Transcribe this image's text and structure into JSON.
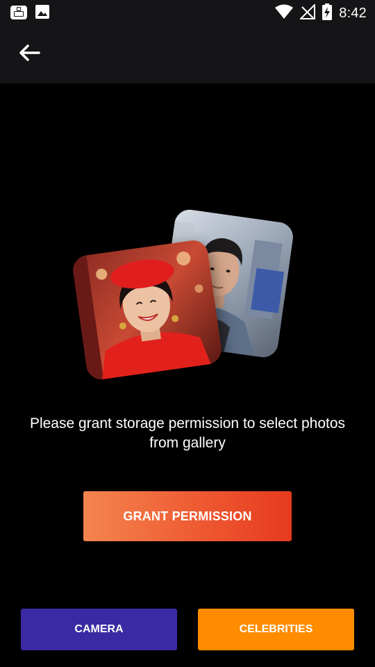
{
  "status_bar": {
    "time": "8:42",
    "icons": [
      "app-notification-icon",
      "image-notification-icon",
      "wifi-icon",
      "no-signal-icon",
      "battery-charging-icon"
    ]
  },
  "app_bar": {
    "back_icon": "arrow-left-icon"
  },
  "illustration": {
    "photos": [
      "woman-in-red-beret-photo",
      "man-in-denim-jacket-photo"
    ]
  },
  "main": {
    "message": "Please grant storage permission to select photos from gallery",
    "grant_button": "GRANT PERMISSION"
  },
  "bottom": {
    "camera_label": "CAMERA",
    "celebrities_label": "CELEBRITIES"
  },
  "colors": {
    "background": "#000000",
    "bar": "#151517",
    "grant_gradient_start": "#f4854f",
    "grant_gradient_end": "#e63a1e",
    "camera": "#3a2aa3",
    "celebrities": "#ff8c00"
  }
}
